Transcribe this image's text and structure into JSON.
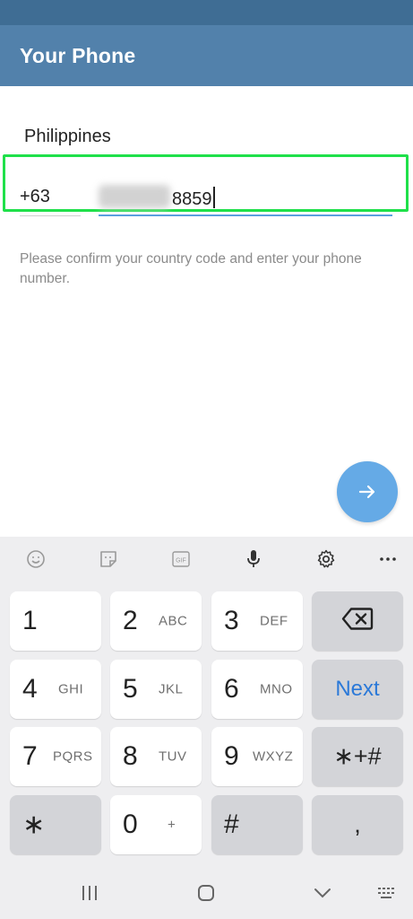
{
  "header": {
    "title": "Your Phone"
  },
  "form": {
    "country": "Philippines",
    "country_code": "+63",
    "phone_number_visible": "8859",
    "hint": "Please confirm your country code and enter your phone number."
  },
  "colors": {
    "app_bar": "#5281ab",
    "status_bar": "#3f6d94",
    "accent": "#65aae6",
    "highlight": "#1fe04a",
    "next_key_text": "#2b79d8"
  },
  "fab": {
    "icon": "arrow-right-icon"
  },
  "keyboard": {
    "toolbar_icons": [
      "emoji-icon",
      "sticker-icon",
      "gif-icon",
      "microphone-icon",
      "settings-icon",
      "more-icon"
    ],
    "gif_text": "GIF",
    "keys": {
      "k1": {
        "digit": "1",
        "letters": ""
      },
      "k2": {
        "digit": "2",
        "letters": "ABC"
      },
      "k3": {
        "digit": "3",
        "letters": "DEF"
      },
      "k4": {
        "digit": "4",
        "letters": "GHI"
      },
      "k5": {
        "digit": "5",
        "letters": "JKL"
      },
      "k6": {
        "digit": "6",
        "letters": "MNO"
      },
      "k7": {
        "digit": "7",
        "letters": "PQRS"
      },
      "k8": {
        "digit": "8",
        "letters": "TUV"
      },
      "k9": {
        "digit": "9",
        "letters": "WXYZ"
      },
      "k0": {
        "digit": "0",
        "letters": "+"
      },
      "star": "∗",
      "hash": "#",
      "comma": ",",
      "sym": "∗+#",
      "next": "Next",
      "backspace_icon": "backspace-icon"
    }
  },
  "nav": {
    "icons": [
      "recents-icon",
      "home-icon",
      "back-icon",
      "keyboard-switch-icon"
    ]
  }
}
